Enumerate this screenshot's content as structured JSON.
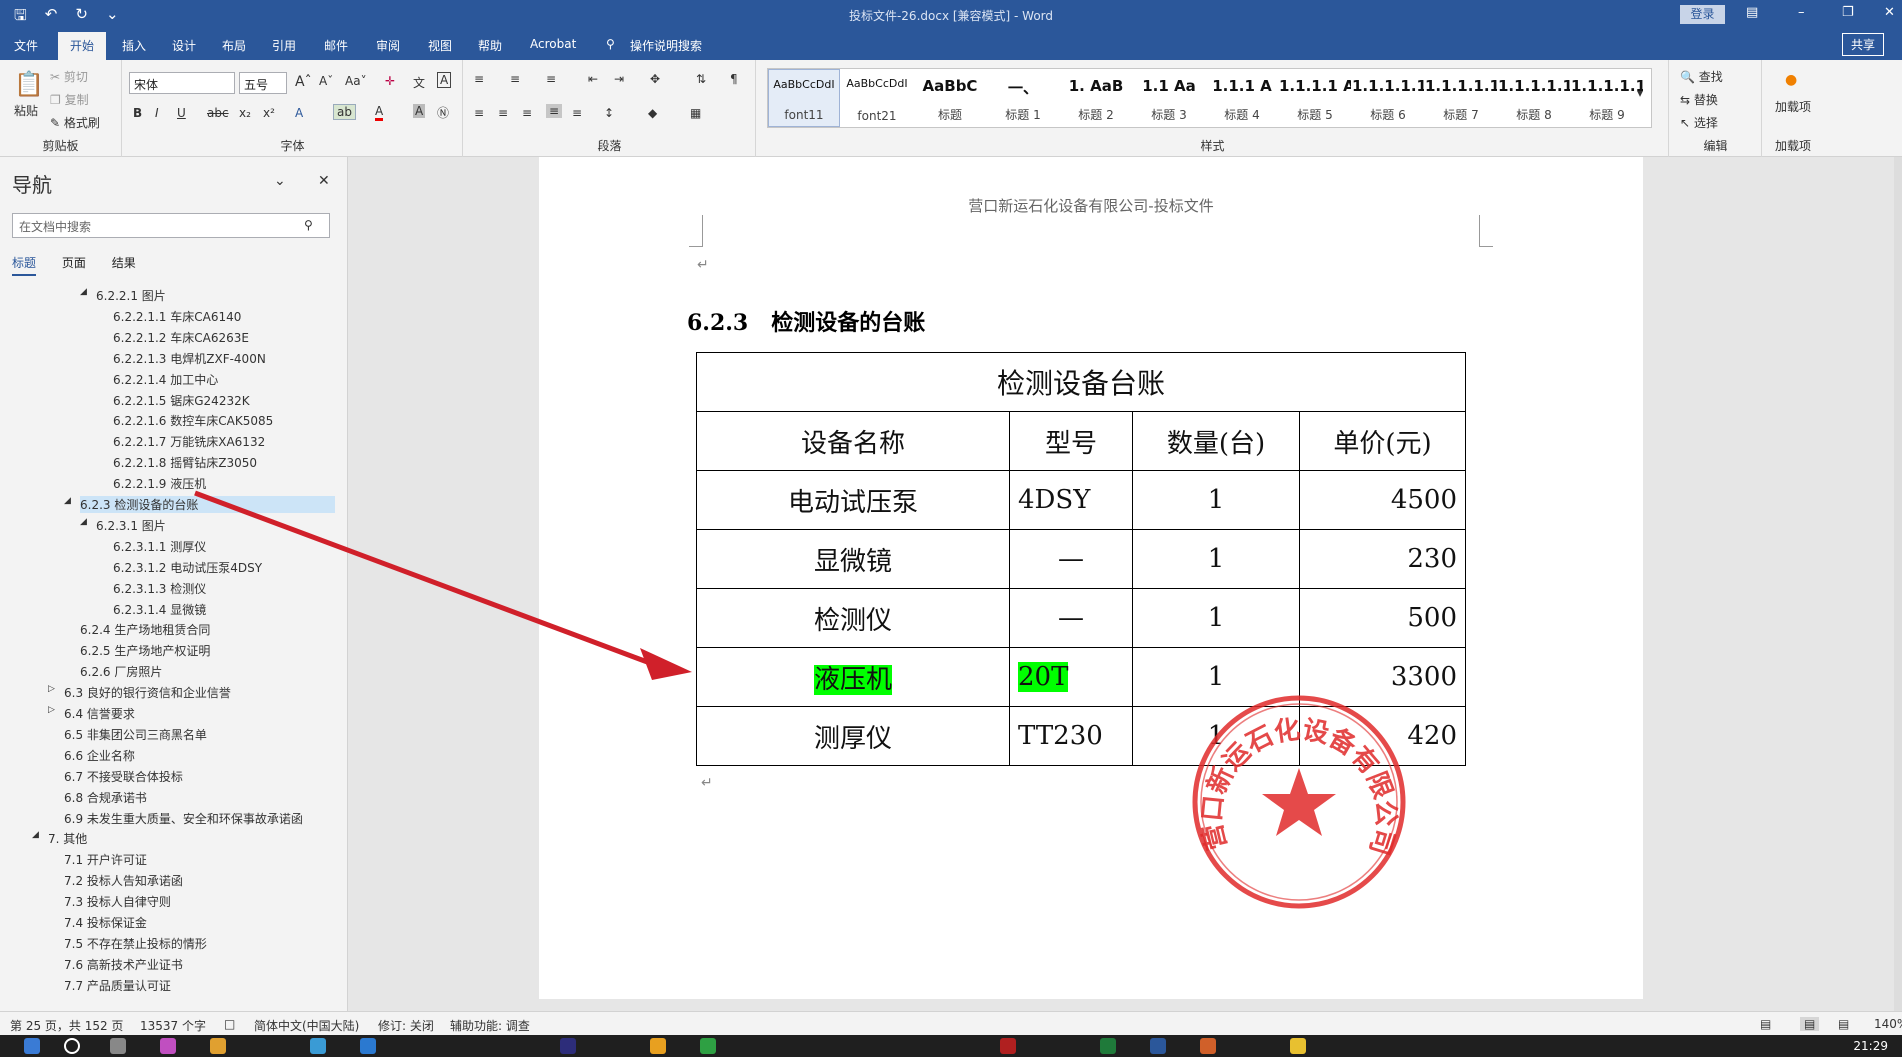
{
  "window": {
    "title": "投标文件-26.docx [兼容模式] - Word",
    "login": "登录"
  },
  "tabs": [
    "文件",
    "开始",
    "插入",
    "设计",
    "布局",
    "引用",
    "邮件",
    "审阅",
    "视图",
    "帮助",
    "Acrobat",
    "操作说明搜索"
  ],
  "share": "共享",
  "ribbon": {
    "clipboard": {
      "paste": "粘贴",
      "cut": "剪切",
      "copy": "复制",
      "painter": "格式刷",
      "label": "剪贴板"
    },
    "font": {
      "name": "宋体",
      "size": "五号",
      "label": "字体"
    },
    "paragraph": {
      "label": "段落"
    },
    "styles": {
      "label": "样式",
      "items": [
        {
          "preview": "AaBbCcDdI",
          "name": "font11"
        },
        {
          "preview": "AaBbCcDdI",
          "name": "font21"
        },
        {
          "preview": "AaBbC",
          "name": "标题"
        },
        {
          "preview": "一、",
          "name": "标题 1"
        },
        {
          "preview": "1. AaB",
          "name": "标题 2"
        },
        {
          "preview": "1.1 Aa",
          "name": "标题 3"
        },
        {
          "preview": "1.1.1 A",
          "name": "标题 4"
        },
        {
          "preview": "1.1.1.1 A",
          "name": "标题 5"
        },
        {
          "preview": "1.1.1.1.1",
          "name": "标题 6"
        },
        {
          "preview": "1.1.1.1.1.",
          "name": "标题 7"
        },
        {
          "preview": "1.1.1.1.1.1",
          "name": "标题 8"
        },
        {
          "preview": "1.1.1.1.1.1",
          "name": "标题 9"
        }
      ]
    },
    "editing": {
      "find": "查找",
      "replace": "替换",
      "select": "选择",
      "label": "编辑"
    },
    "addins": {
      "load": "加载项",
      "label": "加载项"
    }
  },
  "nav": {
    "title": "导航",
    "search_placeholder": "在文档中搜索",
    "tabs": [
      "标题",
      "页面",
      "结果"
    ],
    "items": [
      "6.2.2.1 图片",
      "6.2.2.1.1 车床CA6140",
      "6.2.2.1.2 车床CA6263E",
      "6.2.2.1.3 电焊机ZXF-400N",
      "6.2.2.1.4 加工中心",
      "6.2.2.1.5 锯床G24232K",
      "6.2.2.1.6 数控车床CAK5085",
      "6.2.2.1.7 万能铣床XA6132",
      "6.2.2.1.8 摇臂钻床Z3050",
      "6.2.2.1.9 液压机",
      "6.2.3 检测设备的台账",
      "6.2.3.1 图片",
      "6.2.3.1.1 测厚仪",
      "6.2.3.1.2 电动试压泵4DSY",
      "6.2.3.1.3 检测仪",
      "6.2.3.1.4 显微镜",
      "6.2.4 生产场地租赁合同",
      "6.2.5 生产场地产权证明",
      "6.2.6 厂房照片",
      "6.3 良好的银行资信和企业信誉",
      "6.4 信誉要求",
      "6.5 非集团公司三商黑名单",
      "6.6 企业名称",
      "6.7 不接受联合体投标",
      "6.8 合规承诺书",
      "6.9 未发生重大质量、安全和环保事故承诺函",
      "7. 其他",
      "7.1 开户许可证",
      "7.2 投标人告知承诺函",
      "7.3 投标人自律守则",
      "7.4 投标保证金",
      "7.5 不存在禁止投标的情形",
      "7.6 高新技术产业证书",
      "7.7 产品质量认可证"
    ]
  },
  "document": {
    "header": "营口新运石化设备有限公司-投标文件",
    "heading_num": "6.2.3",
    "heading_text": "检测设备的台账",
    "table": {
      "title": "检测设备台账",
      "columns": [
        "设备名称",
        "型号",
        "数量(台)",
        "单价(元)"
      ],
      "rows": [
        {
          "name": "电动试压泵",
          "model": "4DSY",
          "qty": "1",
          "price": "4500"
        },
        {
          "name": "显微镜",
          "model": "—",
          "qty": "1",
          "price": "230"
        },
        {
          "name": "检测仪",
          "model": "—",
          "qty": "1",
          "price": "500"
        },
        {
          "name": "液压机",
          "model": "20T",
          "qty": "1",
          "price": "3300"
        },
        {
          "name": "测厚仪",
          "model": "TT230",
          "qty": "1",
          "price": "420"
        }
      ]
    },
    "stamp_text": "营口新运石化设备有限公司"
  },
  "status": {
    "page": "第 25 页，共 152 页",
    "words": "13537 个字",
    "lang": "简体中文(中国大陆)",
    "track": "修订: 关闭",
    "access": "辅助功能: 调查",
    "zoom": "140%"
  },
  "clock": "21:29",
  "colors": {
    "brand": "#2b579a",
    "highlight": "#00ff00",
    "arrow": "#d0202a",
    "stamp": "#e02a2a"
  }
}
